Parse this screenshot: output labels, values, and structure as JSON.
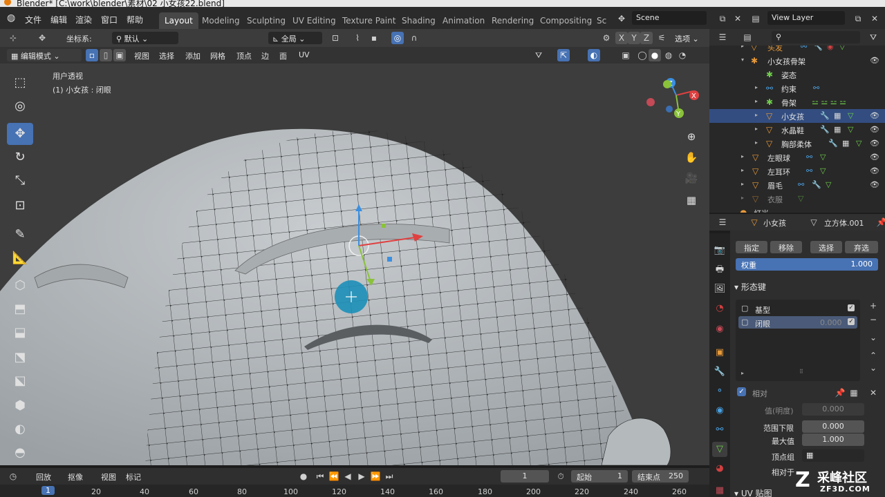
{
  "window": {
    "title": "Blender* [C:\\work\\blender\\素材\\02 小女孩22.blend]"
  },
  "menu": [
    "文件",
    "编辑",
    "渲染",
    "窗口",
    "帮助"
  ],
  "workspaces": [
    "Layout",
    "Modeling",
    "Sculpting",
    "UV Editing",
    "Texture Paint",
    "Shading",
    "Animation",
    "Rendering",
    "Compositing",
    "Sc"
  ],
  "scene": "Scene",
  "view_layer": "View Layer",
  "header1": {
    "coord_label": "坐标系:",
    "coord_value": "默认",
    "orientation": "全局",
    "options": "选项",
    "axes": [
      "X",
      "Y",
      "Z"
    ]
  },
  "header2": {
    "mode": "编辑模式",
    "items": [
      "视图",
      "选择",
      "添加",
      "网格",
      "顶点",
      "边",
      "面",
      "UV"
    ]
  },
  "viewport": {
    "view_name": "用户透视",
    "object_info": "(1) 小女孩 : 闭眼"
  },
  "outliner": [
    {
      "label": "头发",
      "indent": 1,
      "tri": "▸"
    },
    {
      "label": "小女孩骨架",
      "indent": 1,
      "tri": "▾"
    },
    {
      "label": "姿态",
      "indent": 2,
      "tri": ""
    },
    {
      "label": "约束",
      "indent": 2,
      "tri": "▸"
    },
    {
      "label": "骨架",
      "indent": 2,
      "tri": "▸"
    },
    {
      "label": "小女孩",
      "indent": 2,
      "tri": "▸"
    },
    {
      "label": "水晶鞋",
      "indent": 2,
      "tri": "▸"
    },
    {
      "label": "胸部柔体",
      "indent": 2,
      "tri": "▸"
    },
    {
      "label": "左眼球",
      "indent": 1,
      "tri": "▸"
    },
    {
      "label": "左耳环",
      "indent": 1,
      "tri": "▸"
    },
    {
      "label": "眉毛",
      "indent": 1,
      "tri": "▸"
    },
    {
      "label": "衣服",
      "indent": 1,
      "tri": "▸"
    },
    {
      "label": "灯光",
      "indent": 0,
      "tri": "▸"
    }
  ],
  "properties": {
    "object_name": "小女孩",
    "mesh_name": "立方体.001",
    "vgroup_buttons": [
      "指定",
      "移除",
      "选择",
      "弃选"
    ],
    "weight_label": "权重",
    "weight_value": "1.000",
    "shape_keys_title": "形态键",
    "shape_keys": [
      {
        "name": "基型",
        "value": ""
      },
      {
        "name": "闭眼",
        "value": "0.000"
      }
    ],
    "relative_label": "相对",
    "value_label": "值(明度)",
    "value_value": "0.000",
    "range_min_label": "范围下限",
    "range_min_value": "0.000",
    "max_label": "最大值",
    "max_value": "1.000",
    "vertex_group_label": "顶点组",
    "relative_to_label": "相对于",
    "uv_maps_title": "UV 贴图"
  },
  "timeline": {
    "items": [
      "回放",
      "抠像",
      "视图",
      "标记"
    ],
    "current_frame": "1",
    "start_label": "起始",
    "start_value": "1",
    "end_label": "结束点",
    "end_value": "250",
    "ticks": [
      "1",
      "20",
      "40",
      "60",
      "80",
      "100",
      "120",
      "140",
      "160",
      "180",
      "200",
      "220",
      "240",
      "260"
    ]
  },
  "watermark": {
    "brand": "采峰社区",
    "url": "ZF3D.COM"
  },
  "colors": {
    "accent": "#4772b3",
    "orange": "#e89a3a",
    "green": "#6fd04a"
  }
}
